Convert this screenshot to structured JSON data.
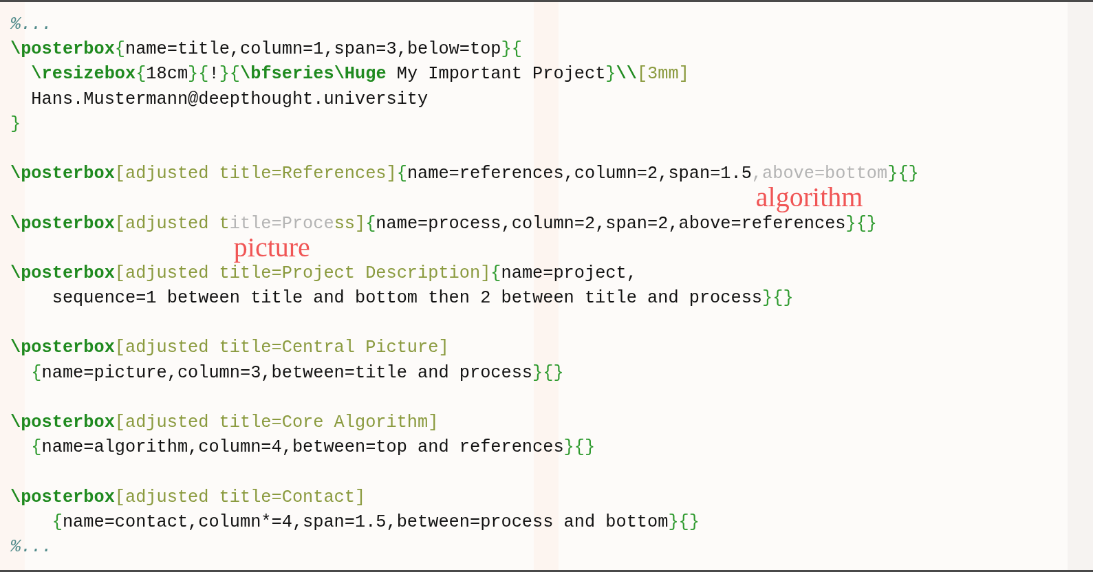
{
  "blocks": [
    {
      "lines": [
        {
          "segments": [
            {
              "kind": "comment",
              "text": "%..."
            }
          ]
        },
        {
          "segments": [
            {
              "kind": "command",
              "text": "\\posterbox"
            },
            {
              "kind": "brace",
              "text": "{"
            },
            {
              "kind": "text",
              "text": "name=title,column=1,span=3,below=top"
            },
            {
              "kind": "brace",
              "text": "}{"
            }
          ]
        },
        {
          "segments": [
            {
              "kind": "command",
              "text": "  \\resizebox"
            },
            {
              "kind": "brace",
              "text": "{"
            },
            {
              "kind": "text",
              "text": "18cm"
            },
            {
              "kind": "brace",
              "text": "}{"
            },
            {
              "kind": "text",
              "text": "!"
            },
            {
              "kind": "brace",
              "text": "}{"
            },
            {
              "kind": "command",
              "text": "\\bfseries\\Huge"
            },
            {
              "kind": "text",
              "text": " My Important Project"
            },
            {
              "kind": "brace",
              "text": "}"
            },
            {
              "kind": "command",
              "text": "\\\\"
            },
            {
              "kind": "option",
              "text": "[3mm]"
            }
          ]
        },
        {
          "segments": [
            {
              "kind": "text",
              "text": "  Hans.Mustermann@deepthought.university"
            }
          ]
        },
        {
          "segments": [
            {
              "kind": "brace",
              "text": "}"
            }
          ]
        }
      ]
    },
    {
      "lines": [
        {
          "segments": [
            {
              "kind": "command",
              "text": "\\posterbox"
            },
            {
              "kind": "option",
              "text": "[adjusted title=References]"
            },
            {
              "kind": "brace",
              "text": "{"
            },
            {
              "kind": "text",
              "text": "name=references,column=2,span=1.5"
            },
            {
              "kind": "faded",
              "text": ",above=bottom"
            },
            {
              "kind": "brace",
              "text": "}{}"
            }
          ],
          "note": "algorithm"
        }
      ]
    },
    {
      "lines": [
        {
          "segments": [
            {
              "kind": "command",
              "text": "\\posterbox"
            },
            {
              "kind": "option",
              "text": "[adjusted t"
            },
            {
              "kind": "faded",
              "text": "itle=Proce"
            },
            {
              "kind": "option",
              "text": "ss]"
            },
            {
              "kind": "brace",
              "text": "{"
            },
            {
              "kind": "text",
              "text": "name=process,column=2,span=2,above=references"
            },
            {
              "kind": "brace",
              "text": "}{}"
            }
          ],
          "note": "picture"
        }
      ]
    },
    {
      "lines": [
        {
          "segments": [
            {
              "kind": "command",
              "text": "\\posterbox"
            },
            {
              "kind": "option",
              "text": "[adjusted title=Project Description]"
            },
            {
              "kind": "brace",
              "text": "{"
            },
            {
              "kind": "text",
              "text": "name=project,"
            }
          ]
        },
        {
          "segments": [
            {
              "kind": "text",
              "text": "    sequence=1 between title and bottom then 2 between title and process"
            },
            {
              "kind": "brace",
              "text": "}{}"
            }
          ]
        }
      ]
    },
    {
      "lines": [
        {
          "segments": [
            {
              "kind": "command",
              "text": "\\posterbox"
            },
            {
              "kind": "option",
              "text": "[adjusted title=Central Picture]"
            }
          ]
        },
        {
          "segments": [
            {
              "kind": "brace",
              "text": "  {"
            },
            {
              "kind": "text",
              "text": "name=picture,column=3,between=title and process"
            },
            {
              "kind": "brace",
              "text": "}{}"
            }
          ]
        }
      ]
    },
    {
      "lines": [
        {
          "segments": [
            {
              "kind": "command",
              "text": "\\posterbox"
            },
            {
              "kind": "option",
              "text": "[adjusted title=Core Algorithm]"
            }
          ]
        },
        {
          "segments": [
            {
              "kind": "brace",
              "text": "  {"
            },
            {
              "kind": "text",
              "text": "name=algorithm,column=4,between=top and references"
            },
            {
              "kind": "brace",
              "text": "}{}"
            }
          ]
        }
      ]
    },
    {
      "lines": [
        {
          "segments": [
            {
              "kind": "command",
              "text": "\\posterbox"
            },
            {
              "kind": "option",
              "text": "[adjusted title=Contact]"
            }
          ]
        },
        {
          "segments": [
            {
              "kind": "brace",
              "text": "    {"
            },
            {
              "kind": "text",
              "text": "name=contact,column*=4,span=1.5,between=process and bottom"
            },
            {
              "kind": "brace",
              "text": "}{}"
            }
          ]
        },
        {
          "segments": [
            {
              "kind": "comment",
              "text": "%..."
            }
          ]
        }
      ]
    }
  ]
}
